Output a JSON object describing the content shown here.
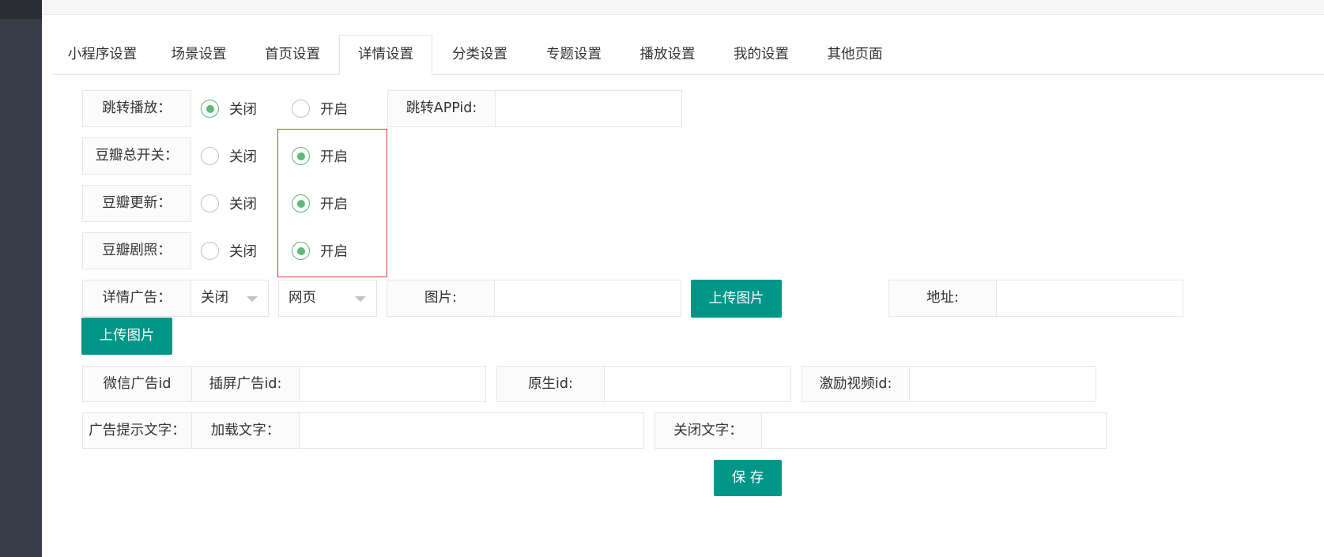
{
  "colors": {
    "sidebar_bg": "#393D49",
    "accent": "#009688",
    "radio_checked": "#5FB878",
    "radio_unchecked": "#C2C2C2",
    "highlight_border": "#E8393A"
  },
  "icons": {
    "radio": "radio-circle-icon",
    "select_caret": "caret-down-icon"
  },
  "tabs": [
    {
      "label": "小程序设置",
      "active": false
    },
    {
      "label": "场景设置",
      "active": false
    },
    {
      "label": "首页设置",
      "active": false
    },
    {
      "label": "详情设置",
      "active": true
    },
    {
      "label": "分类设置",
      "active": false
    },
    {
      "label": "专题设置",
      "active": false
    },
    {
      "label": "播放设置",
      "active": false
    },
    {
      "label": "我的设置",
      "active": false
    },
    {
      "label": "其他页面",
      "active": false
    }
  ],
  "form": {
    "jump_play": {
      "label": "跳转播放：",
      "options": [
        "关闭",
        "开启"
      ],
      "selected": "关闭"
    },
    "jump_appid": {
      "label": "跳转APPid:",
      "value": ""
    },
    "douban_master": {
      "label": "豆瓣总开关：",
      "options": [
        "关闭",
        "开启"
      ],
      "selected": "开启"
    },
    "douban_update": {
      "label": "豆瓣更新：",
      "options": [
        "关闭",
        "开启"
      ],
      "selected": "开启"
    },
    "douban_stills": {
      "label": "豆瓣剧照：",
      "options": [
        "关闭",
        "开启"
      ],
      "selected": "开启"
    },
    "detail_ad": {
      "label": "详情广告：",
      "status": "关闭",
      "type": "网页"
    },
    "image": {
      "label": "图片:",
      "value": ""
    },
    "upload_button_1": "上传图片",
    "address": {
      "label": "地址:",
      "value": ""
    },
    "upload_button_2": "上传图片",
    "wechat_ad": {
      "label": "微信广告id",
      "interstitial": {
        "label": "插屏广告id:",
        "value": ""
      },
      "native": {
        "label": "原生id:",
        "value": ""
      },
      "rewarded_video": {
        "label": "激励视频id:",
        "value": ""
      }
    },
    "ad_hint": {
      "label": "广告提示文字：",
      "loading_text": {
        "label": "加载文字：",
        "value": ""
      },
      "close_text": {
        "label": "关闭文字：",
        "value": ""
      }
    },
    "save_label": "保 存"
  }
}
